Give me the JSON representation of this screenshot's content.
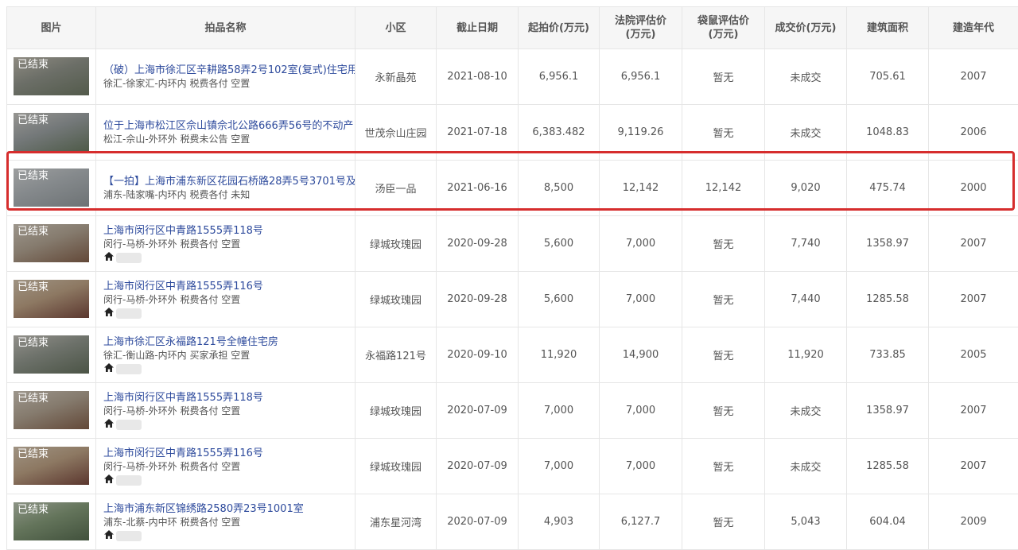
{
  "headers": [
    "图片",
    "拍品名称",
    "小区",
    "截止日期",
    "起拍价(万元)",
    "法院评估价\n(万元)",
    "袋鼠评估价\n(万元)",
    "成交价(万元)",
    "建筑面积",
    "建造年代"
  ],
  "status_tag": "已结束",
  "rows": [
    {
      "title": "（破）上海市徐汇区辛耕路58弄2号102室(复式)住宅用",
      "sub": "徐汇-徐家汇-内环内 税费各付 空置",
      "icon": false,
      "community": "永新晶苑",
      "deadline": "2021-08-10",
      "start_price": "6,956.1",
      "court_value": "6,956.1",
      "kangaroo_value": "暂无",
      "deal_price": "未成交",
      "area": "705.61",
      "year": "2007",
      "thumb": [
        "#8a8f82",
        "#5d6b4f",
        "#c9c3b2"
      ]
    },
    {
      "title": "位于上海市松江区佘山镇佘北公路666弄56号的不动产",
      "sub": "松江-佘山-外环外 税费未公告 空置",
      "icon": false,
      "community": "世茂佘山庄园",
      "deadline": "2021-07-18",
      "start_price": "6,383.482",
      "court_value": "9,119.26",
      "kangaroo_value": "暂无",
      "deal_price": "未成交",
      "area": "1048.83",
      "year": "2006",
      "thumb": [
        "#9aa2a4",
        "#556b4a",
        "#d8d6cf"
      ]
    },
    {
      "title": "【一拍】上海市浦东新区花园石桥路28弄5号3701号及",
      "sub": "浦东-陆家嘴-内环内 税费各付 未知",
      "icon": false,
      "community": "汤臣一品",
      "deadline": "2021-06-16",
      "start_price": "8,500",
      "court_value": "12,142",
      "kangaroo_value": "12,142",
      "deal_price": "9,020",
      "area": "475.74",
      "year": "2000",
      "thumb": [
        "#b7bfc4",
        "#8d969a",
        "#e3e6e7"
      ]
    },
    {
      "title": "上海市闵行区中青路1555弄118号",
      "sub": "闵行-马桥-外环外 税费各付 空置",
      "icon": true,
      "community": "绿城玫瑰园",
      "deadline": "2020-09-28",
      "start_price": "5,600",
      "court_value": "7,000",
      "kangaroo_value": "暂无",
      "deal_price": "7,740",
      "area": "1358.97",
      "year": "2007",
      "thumb": [
        "#b9a68e",
        "#7a4a2c",
        "#e2d6c4"
      ]
    },
    {
      "title": "上海市闵行区中青路1555弄116号",
      "sub": "闵行-马桥-外环外 税费各付 空置",
      "icon": true,
      "community": "绿城玫瑰园",
      "deadline": "2020-09-28",
      "start_price": "5,600",
      "court_value": "7,000",
      "kangaroo_value": "暂无",
      "deal_price": "7,440",
      "area": "1285.58",
      "year": "2007",
      "thumb": [
        "#c7a27a",
        "#6d2b1c",
        "#e7d1b3"
      ]
    },
    {
      "title": "上海市徐汇区永福路121号全幢住宅房",
      "sub": "徐汇-衡山路-内环内 买家承担 空置",
      "icon": true,
      "community": "永福路121号",
      "deadline": "2020-09-10",
      "start_price": "11,920",
      "court_value": "14,900",
      "kangaroo_value": "暂无",
      "deal_price": "11,920",
      "area": "733.85",
      "year": "2005",
      "thumb": [
        "#8c9487",
        "#4f5f45",
        "#d0ccc2"
      ]
    },
    {
      "title": "上海市闵行区中青路1555弄118号",
      "sub": "闵行-马桥-外环外 税费各付 空置",
      "icon": true,
      "community": "绿城玫瑰园",
      "deadline": "2020-07-09",
      "start_price": "7,000",
      "court_value": "7,000",
      "kangaroo_value": "暂无",
      "deal_price": "未成交",
      "area": "1358.97",
      "year": "2007",
      "thumb": [
        "#b9a68e",
        "#7a4a2c",
        "#e2d6c4"
      ]
    },
    {
      "title": "上海市闵行区中青路1555弄116号",
      "sub": "闵行-马桥-外环外 税费各付 空置",
      "icon": true,
      "community": "绿城玫瑰园",
      "deadline": "2020-07-09",
      "start_price": "7,000",
      "court_value": "7,000",
      "kangaroo_value": "暂无",
      "deal_price": "未成交",
      "area": "1285.58",
      "year": "2007",
      "thumb": [
        "#c7a27a",
        "#6d2b1c",
        "#e7d1b3"
      ]
    },
    {
      "title": "上海市浦东新区锦绣路2580弄23号1001室",
      "sub": "浦东-北蔡-内中环 税费各付 空置",
      "icon": true,
      "community": "浦东星河湾",
      "deadline": "2020-07-09",
      "start_price": "4,903",
      "court_value": "6,127.7",
      "kangaroo_value": "暂无",
      "deal_price": "5,043",
      "area": "604.04",
      "year": "2009",
      "thumb": [
        "#7c9a6c",
        "#3d5a34",
        "#c6d3b9"
      ]
    }
  ],
  "highlighted_row": 2,
  "highlight_color": "#d62d2d",
  "link_color": "#2d4a9c"
}
